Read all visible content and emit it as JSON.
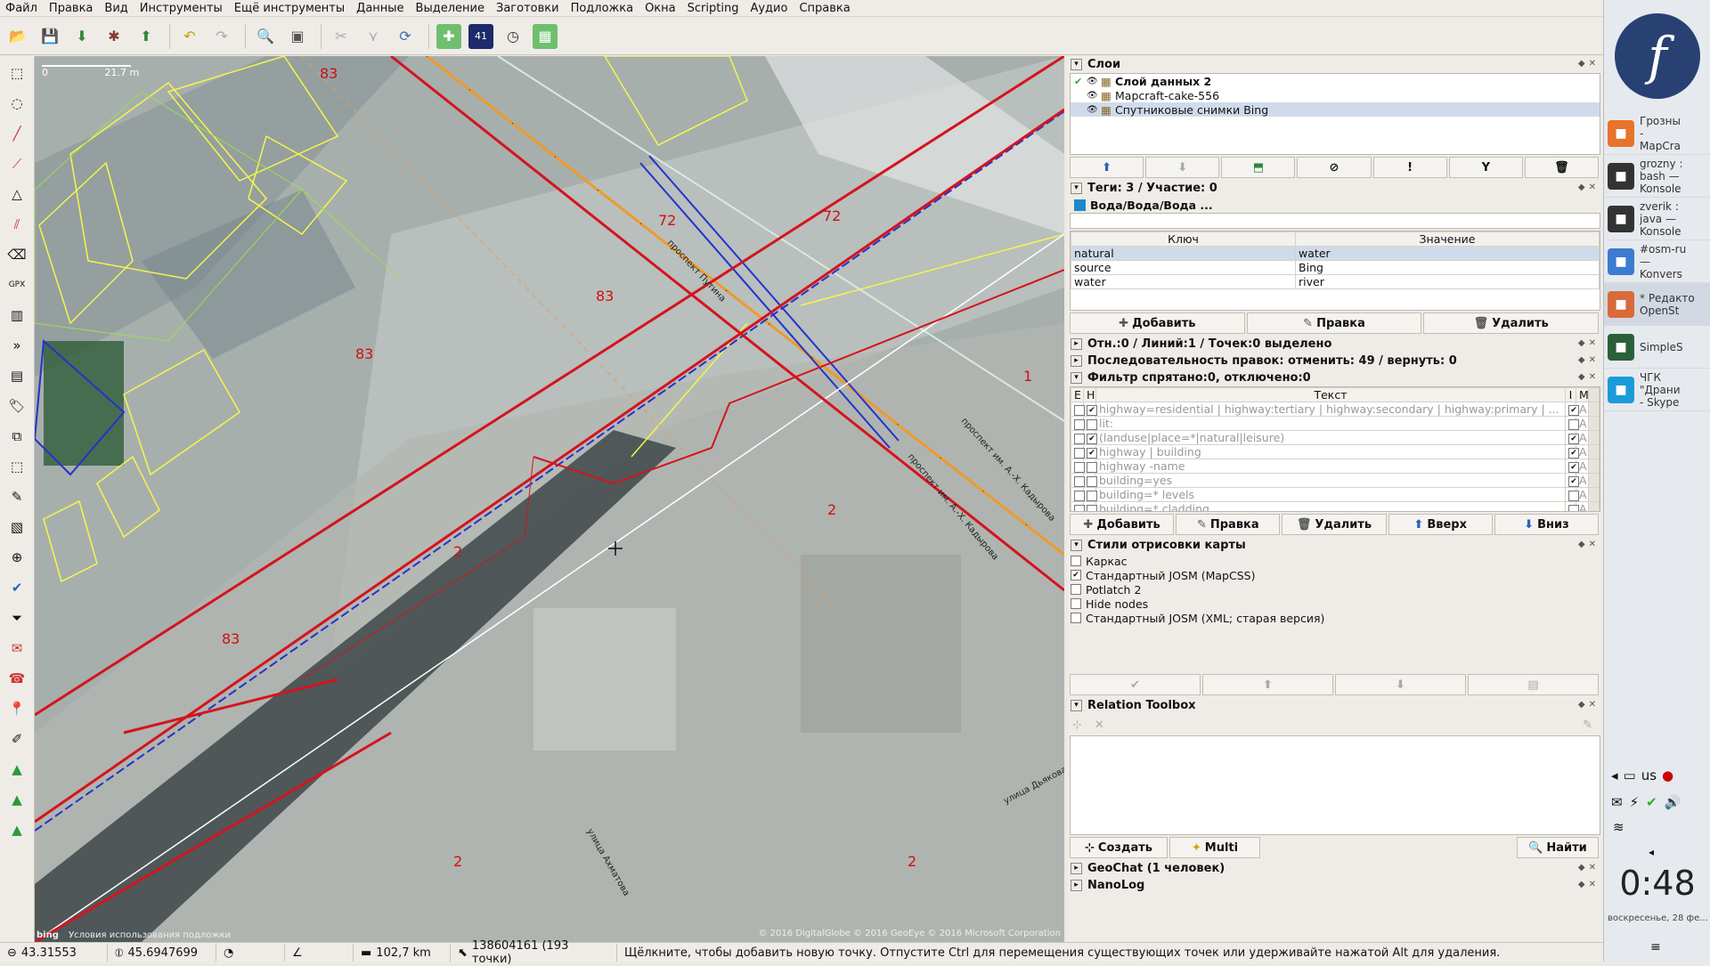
{
  "menubar": [
    "Файл",
    "Правка",
    "Вид",
    "Инструменты",
    "Ещё инструменты",
    "Данные",
    "Выделение",
    "Заготовки",
    "Подложка",
    "Окна",
    "Scripting",
    "Аудио",
    "Справка"
  ],
  "map": {
    "scale_label": "21.7 m",
    "scale_zero": "0",
    "attribution": "© 2016 DigitalGlobe © 2016 GeoEye © 2016 Microsoft Corporation",
    "terms": "Условия использования подложки",
    "bing_logo": "bing",
    "labels": [
      "83",
      "83",
      "83",
      "83",
      "72",
      "72",
      "1",
      "2",
      "2",
      "2",
      "2",
      "проспект Путина",
      "проспект им. А.-Х. Кадырова",
      "проспект им. А.-Х. Кадырова",
      "улица Дьякова",
      "улица Ахматова"
    ]
  },
  "layers": {
    "title": "Слои",
    "items": [
      {
        "name": "Слой данных 2",
        "active": true
      },
      {
        "name": "Mapcraft-cake-556",
        "active": false
      },
      {
        "name": "Спутниковые снимки Bing",
        "active": false
      }
    ]
  },
  "tags": {
    "title": "Теги: 3 / Участие: 0",
    "preset": "Вода/Вода/Вода ...",
    "col_key": "Ключ",
    "col_value": "Значение",
    "rows": [
      {
        "key": "natural",
        "value": "water"
      },
      {
        "key": "source",
        "value": "Bing"
      },
      {
        "key": "water",
        "value": "river"
      }
    ],
    "buttons": [
      "Добавить",
      "Правка",
      "Удалить"
    ]
  },
  "selection": {
    "title": "Отн.:0 / Линий:1 / Точек:0 выделено"
  },
  "history": {
    "title": "Последовательность правок: отменить: 49 / вернуть: 0"
  },
  "filter": {
    "title": "Фильтр спрятано:0, отключено:0",
    "col_e": "E",
    "col_h": "H",
    "col_text": "Текст",
    "col_i": "I",
    "col_m": "M",
    "rows": [
      {
        "text": "highway=residential | highway:tertiary | highway:secondary | highway:primary | ...",
        "h": true,
        "i": true,
        "m": "A"
      },
      {
        "text": "lit:",
        "h": false,
        "i": false,
        "m": "A"
      },
      {
        "text": "(landuse|place=*|natural|leisure)",
        "h": true,
        "i": true,
        "m": "A"
      },
      {
        "text": "highway | building",
        "h": true,
        "i": true,
        "m": "A"
      },
      {
        "text": "highway -name",
        "h": false,
        "i": true,
        "m": "A"
      },
      {
        "text": "building=yes",
        "h": false,
        "i": true,
        "m": "A"
      },
      {
        "text": "building=* levels",
        "h": false,
        "i": false,
        "m": "A"
      },
      {
        "text": "building=* cladding",
        "h": false,
        "i": false,
        "m": "A"
      }
    ],
    "buttons": [
      "Добавить",
      "Правка",
      "Удалить",
      "Вверх",
      "Вниз"
    ]
  },
  "styles": {
    "title": "Стили отрисовки карты",
    "items": [
      {
        "name": "Каркас",
        "checked": false
      },
      {
        "name": "Стандартный JOSM (MapCSS)",
        "checked": true
      },
      {
        "name": "Potlatch 2",
        "checked": false
      },
      {
        "name": "Hide nodes",
        "checked": false
      },
      {
        "name": "Стандартный JOSM (XML; старая версия)",
        "checked": false
      }
    ]
  },
  "relation_toolbox": {
    "title": "Relation Toolbox",
    "buttons": [
      "Создать",
      "Multi",
      "Найти"
    ]
  },
  "geochat": {
    "title": "GeoChat (1 человек)"
  },
  "nanolog": {
    "title": "NanoLog"
  },
  "statusbar": {
    "lat": "43.31553",
    "lon": "45.6947699",
    "distance": "102,7 km",
    "nodes": "138604161 (193 точки)",
    "message": "Щёлкните, чтобы добавить новую точку. Отпустите Ctrl для перемещения существующих точек или удерживайте нажатой Alt для удаления."
  },
  "taskbar": {
    "tasks": [
      {
        "label": "Грозны\n-\nMapCra",
        "color": "#e8732a"
      },
      {
        "label": "grozny :\nbash —\nKonsole",
        "color": "#333333"
      },
      {
        "label": "zverik :\njava —\nKonsole",
        "color": "#333333"
      },
      {
        "label": "#osm-ru\n—\nKonvers",
        "color": "#3b7bd1"
      },
      {
        "label": "* Редакто\nOpenSt",
        "color": "#d96a3a"
      },
      {
        "label": "SimpleS",
        "color": "#2b5f3a"
      },
      {
        "label": "ЧГК\n\"Драни\n- Skype",
        "color": "#1b9cd8"
      }
    ],
    "kb_layout": "us",
    "clock": "0:48",
    "date": "воскресенье, 28 фе..."
  }
}
